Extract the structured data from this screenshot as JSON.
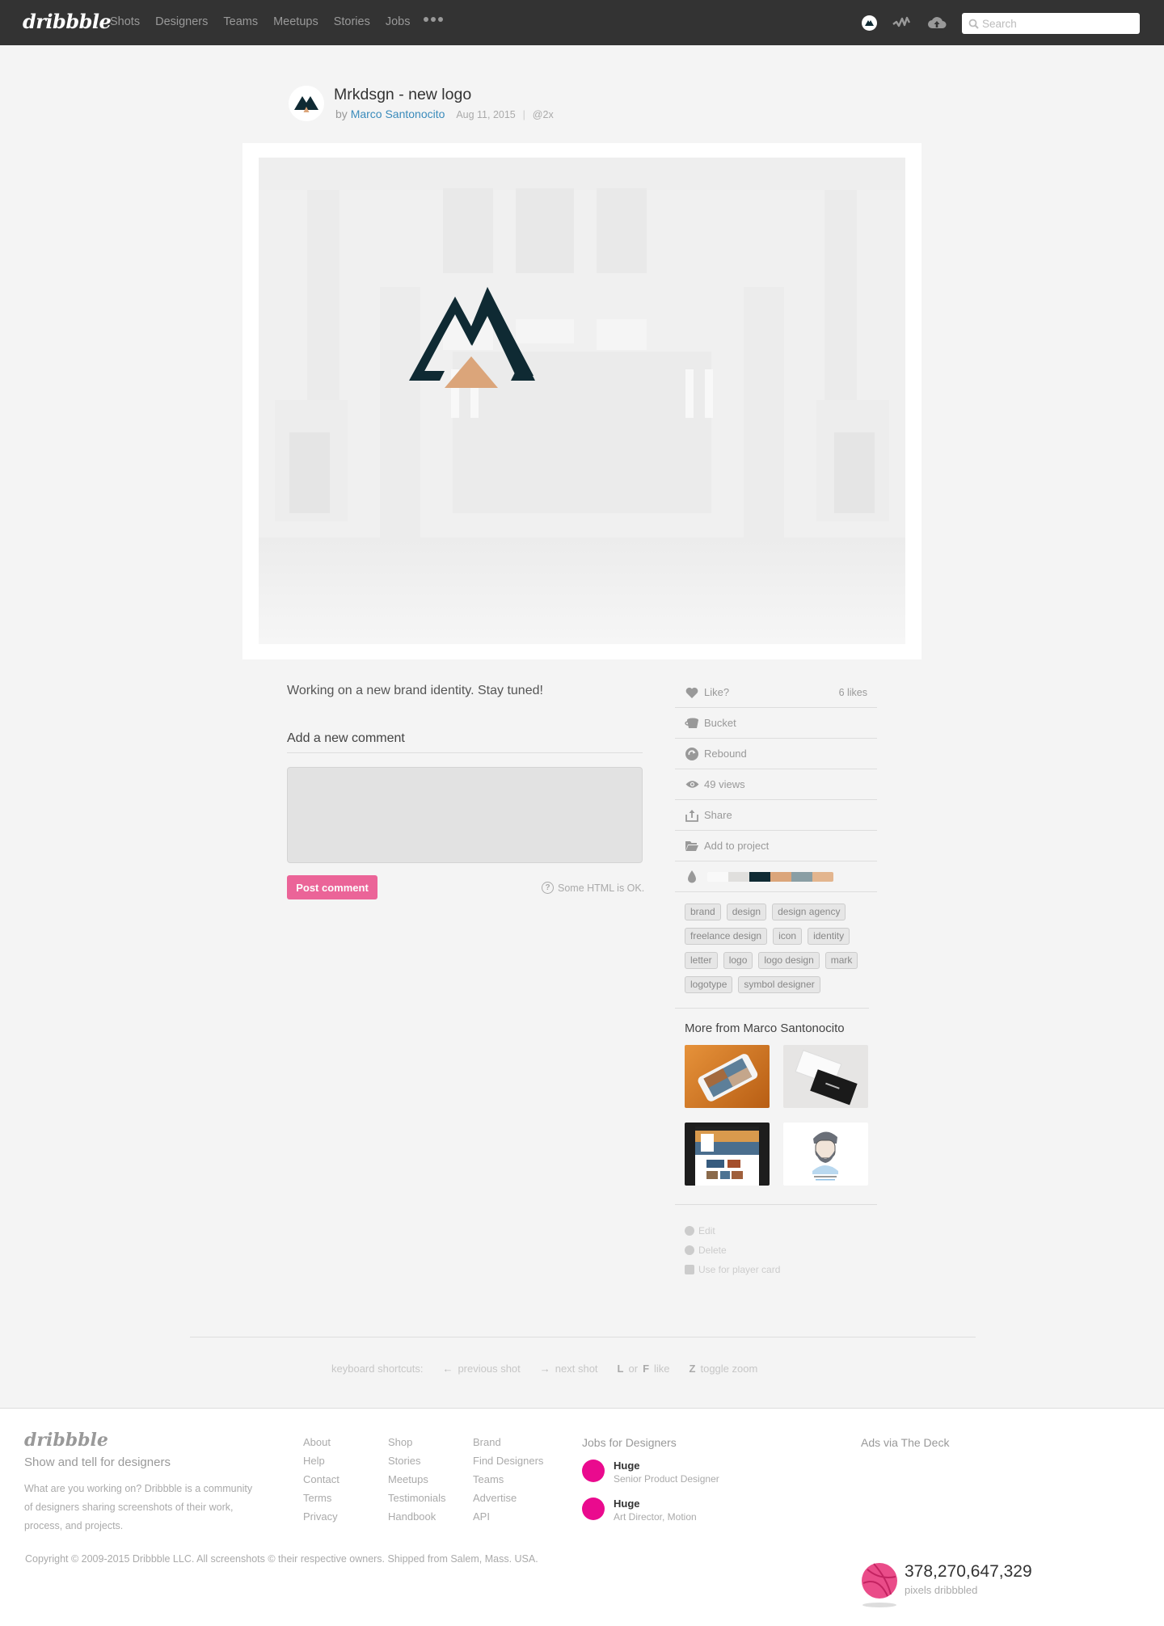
{
  "nav": {
    "logo": "dribbble",
    "links": [
      "Shots",
      "Designers",
      "Teams",
      "Meetups",
      "Stories",
      "Jobs"
    ],
    "more_icon": "ellipsis-icon",
    "icons": [
      "user-avatar-icon",
      "activity-icon",
      "upload-cloud-icon"
    ],
    "search_placeholder": "Search",
    "search_value": ""
  },
  "shot": {
    "title": "Mrkdsgn - new logo",
    "by": "by",
    "author": "Marco Santonocito",
    "date": "Aug 11, 2015",
    "separator": "|",
    "resolution": "@2x",
    "logo_colors": {
      "dark": "#0f2a33",
      "accent": "#dba57a"
    },
    "description": "Working on a new brand identity. Stay tuned!"
  },
  "comment": {
    "heading": "Add a new comment",
    "value": "",
    "post_label": "Post comment",
    "html_note": "Some HTML is OK.",
    "help_icon": "?"
  },
  "sidebar": {
    "actions": [
      {
        "icon": "heart-icon",
        "label": "Like?",
        "right": "6 likes"
      },
      {
        "icon": "bucket-icon",
        "label": "Bucket",
        "right": ""
      },
      {
        "icon": "rebound-icon",
        "label": "Rebound",
        "right": ""
      },
      {
        "icon": "eye-icon",
        "label": "49 views",
        "right": ""
      },
      {
        "icon": "share-icon",
        "label": "Share",
        "right": ""
      },
      {
        "icon": "folder-icon",
        "label": "Add to project",
        "right": ""
      }
    ],
    "palette": [
      "#f9f9f9",
      "#e0dfdd",
      "#0f2a33",
      "#dba57a",
      "#8a9ea4",
      "#e3b58e"
    ],
    "tags": [
      "brand",
      "design",
      "design agency",
      "freelance design",
      "icon",
      "identity",
      "letter",
      "logo",
      "logo design",
      "mark",
      "logotype",
      "symbol designer"
    ],
    "more_heading": "More from Marco Santonocito",
    "owner_actions": [
      "Edit",
      "Delete",
      "Use for player card"
    ]
  },
  "shortcuts": {
    "label": "keyboard shortcuts:",
    "prev_key": "←",
    "prev": "previous shot",
    "next_key": "→",
    "next": "next shot",
    "like_key1": "L",
    "like_or": "or",
    "like_key2": "F",
    "like": "like",
    "zoom_key": "Z",
    "zoom": "toggle zoom"
  },
  "footer": {
    "logo": "dribbble",
    "tagline": "Show and tell for designers",
    "description": "What are you working on? Dribbble is a community of designers sharing screenshots of their work, process, and projects.",
    "col1": [
      "About",
      "Help",
      "Contact",
      "Terms",
      "Privacy"
    ],
    "col2": [
      "Shop",
      "Stories",
      "Meetups",
      "Testimonials",
      "Handbook"
    ],
    "col3": [
      "Brand",
      "Find Designers",
      "Teams",
      "Advertise",
      "API"
    ],
    "jobs_heading": "Jobs for Designers",
    "jobs": [
      {
        "company": "Huge",
        "role": "Senior Product Designer"
      },
      {
        "company": "Huge",
        "role": "Art Director, Motion"
      }
    ],
    "ads": "Ads via The Deck",
    "copyright": "Copyright © 2009-2015 Dribbble LLC. All screenshots © their respective owners. Shipped from Salem, Mass. USA.",
    "pixels_count": "378,270,647,329",
    "pixels_label": "pixels dribbbled"
  }
}
